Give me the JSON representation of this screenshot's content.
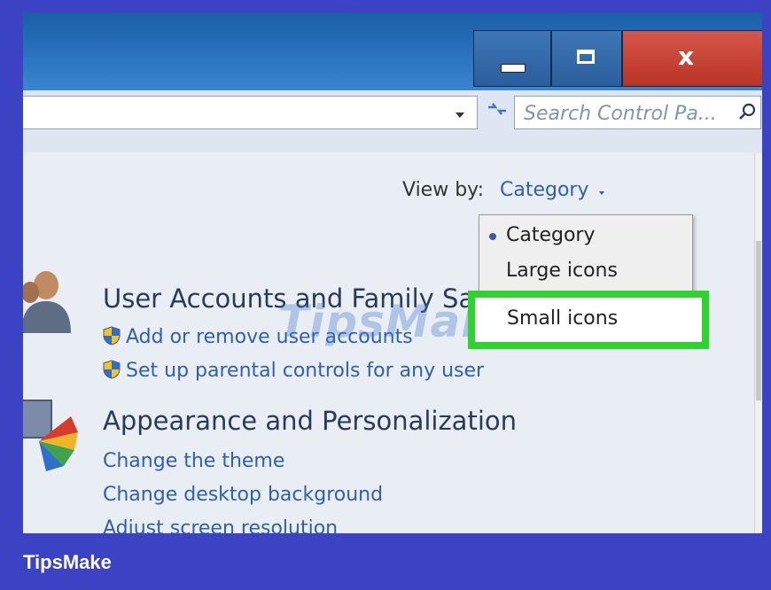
{
  "window": {
    "title_buttons": {
      "minimize_icon": "minimize-icon",
      "maximize_icon": "maximize-icon",
      "close_label": "x"
    }
  },
  "address_bar": {
    "search_placeholder": "Search Control Pa..."
  },
  "view_by": {
    "label": "View by:",
    "value": "Category",
    "menu": {
      "items": [
        "Category",
        "Large icons",
        "Small icons"
      ],
      "selected": "Category",
      "highlighted": "Small icons"
    }
  },
  "sections": [
    {
      "title": "User Accounts and Family Sa",
      "icon": "users-icon",
      "links": [
        "Add or remove user accounts",
        "Set up parental controls for any user"
      ]
    },
    {
      "title": "Appearance and Personalization",
      "icon": "appearance-icon",
      "links": [
        "Change the theme",
        "Change desktop background",
        "Adjust screen resolution"
      ]
    }
  ],
  "watermark": "TipsMake",
  "brand": "TipsMake",
  "colors": {
    "frame": "#3b43c4",
    "titlebar": "#2f78c4",
    "close_button": "#c43b2e",
    "highlight_border": "#2fd32e",
    "link": "#2f5fb0"
  }
}
